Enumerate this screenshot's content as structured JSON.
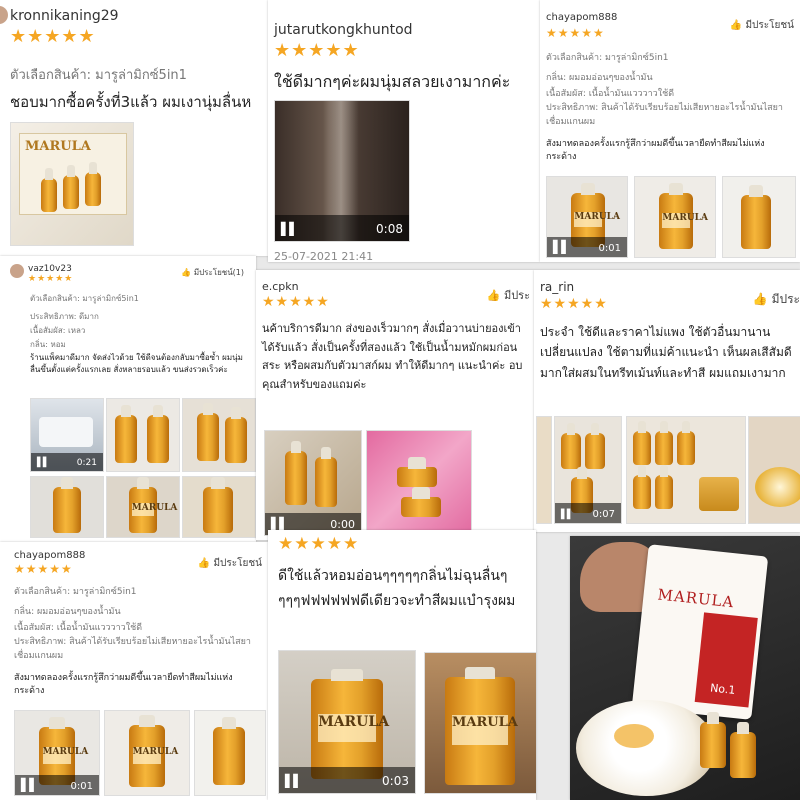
{
  "reviews": [
    {
      "user": "kronnikaning29",
      "stars": "★★★★★",
      "option": "ตัวเลือกสินค้า: มารูล่ามิกซ์5in1",
      "text": "ชอบมากซื้อครั้งที่3แล้ว ผมเงานุ่มลื่นห"
    },
    {
      "user": "jutarutkongkhuntod",
      "stars": "★★★★★",
      "text": "ใช้ดีมากๆค่ะผมนุ่มสลวยเงามากค่ะ",
      "video_time": "0:08",
      "date": "25-07-2021 21:41"
    },
    {
      "user": "chayapom888",
      "stars": "★★★★★",
      "like": "มีประโยชน์",
      "option": "ตัวเลือกสินค้า: มารูล่ามิกซ์5in1",
      "smell": "กลิ่น: ผมอมอ่อนๆของน้ำมัน",
      "texture": "เนื้อสัมผัส: เนื้อน้ำมันแวววาวใช้ดี",
      "effect": "ประสิทธิภาพ: สินค้าได้รับเรียบร้อยไม่เสียหายอะไรน้ำมันไสยาเชื่อมแกนผม",
      "body": "สังมาทดลองครั้งแรกรู้สึกว่าผมดีขึ้นเวลายืดทำสีผมไม่แห่งกระด้าง",
      "video_time": "0:01"
    },
    {
      "user": "vaz10v23",
      "stars": "★★★★★",
      "like": "มีประโยชน์(1)",
      "option": "ตัวเลือกสินค้า: มารูล่ามิกซ์5in1",
      "effect": "ประสิทธิภาพ: ดีมาก",
      "texture": "เนื้อสัมผัส: เหลว",
      "smell": "กลิ่น: หอม",
      "body": "ร้านแพ็คมาดีมาก จัดส่งไวด้วย ใช้ดีจนต้องกลับมาซื้อซ้ำ ผมนุ่มลื่นขึ้นตั้งแต่ครั้งแรกเลย สั่งหลายรอบแล้ว ขนส่งรวดเร็วค่ะ",
      "video_time": "0:21"
    },
    {
      "user": "e.cpkn",
      "stars": "★★★★★",
      "like": "มีประ",
      "text": "นค้าบริการดีมาก ส่งของเร็วมากๆ สั่งเมื่อวานบ่ายองเข้าได้รับแล้ว สั่งเป็นครั้งที่สองแล้ว ใช้เป็นน้ำมหมักผมก่อนสระ หรือผสมกับตัวมาสก์ผม ทำให้ดีมากๆ แนะนำค่ะ อบคุณสำหรับของแถมค่ะ",
      "video_time": "0:00"
    },
    {
      "user": "ra_rin",
      "stars": "★★★★★",
      "like": "มีประ",
      "text": "ประจำ ใช้ดีและราคาไม่แพง ใช้ตัวอื่นมานานเปลี่ยนแปลง ใช้ตามที่แม่ค้าแนะนำ เห็นผลเสีสัมดีมากใส่ผสมในทรีทเม้นท์และทำสี ผมแถมเงามาก",
      "video_time": "0:07"
    },
    {
      "user": "chayapom888",
      "stars": "★★★★★",
      "like": "มีประโยชน์",
      "option": "ตัวเลือกสินค้า: มารูล่ามิกซ์5in1",
      "smell": "กลิ่น: ผมอมอ่อนๆของน้ำมัน",
      "texture": "เนื้อสัมผัส: เนื้อน้ำมันแวววาวใช้ดี",
      "effect": "ประสิทธิภาพ: สินค้าได้รับเรียบร้อยไม่เสียหายอะไรน้ำมันไสยาเชื่อมแกนผม",
      "body": "สังมาทดลองครั้งแรกรู้สึกว่าผมดีขึ้นเวลายืดทำสีผมไม่แห่งกระด้าง",
      "video_time": "0:01"
    },
    {
      "user": "",
      "stars": "★★★★★",
      "text": "ดีใช้แล้วหอมอ่อนๆๆๆๆๆกลิ่นไม่ฉุนลื่นๆๆๆๆฟฟฟฟฟฟดีเดียวจะทำสีผมแบำรุงผม",
      "video_time": "0:03"
    }
  ],
  "brand": {
    "name": "MARULA",
    "product_sub": "No.1"
  },
  "colors": {
    "star": "#f5a623",
    "background": "#e9e9e9"
  }
}
